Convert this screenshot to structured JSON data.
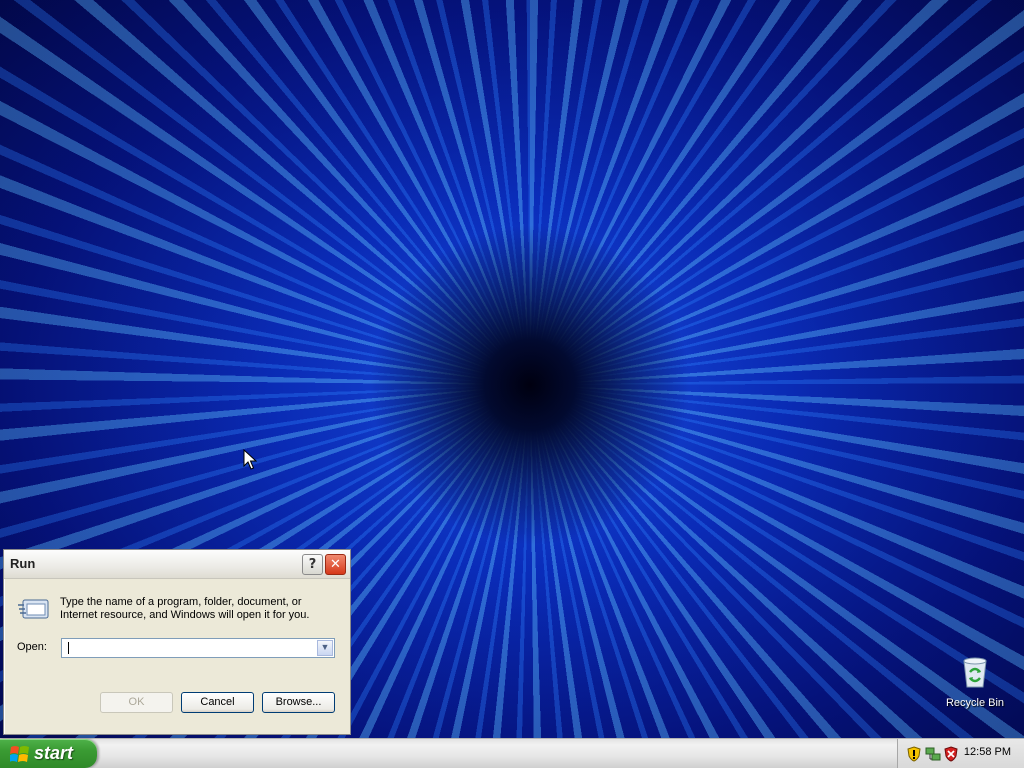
{
  "desktop": {
    "icons": [
      {
        "label": "Recycle Bin",
        "icon": "recycle-bin-icon"
      }
    ]
  },
  "run_dialog": {
    "title": "Run",
    "help_symbol": "?",
    "close_symbol": "✕",
    "description": "Type the name of a program, folder, document, or Internet resource, and Windows will open it for you.",
    "open_label": "Open:",
    "open_value": "",
    "dropdown_symbol": "▼",
    "ok_label": "OK",
    "ok_enabled": false,
    "cancel_label": "Cancel",
    "browse_label": "Browse..."
  },
  "taskbar": {
    "start_label": "start",
    "tray_icons": [
      "security-shield-icon",
      "network-icon",
      "security-alert-icon"
    ],
    "clock": "12:58 PM"
  },
  "colors": {
    "wallpaper_primary": "#0b2fc4",
    "wallpaper_streak": "#50aaff",
    "start_button": "#3a9b33",
    "dialog_bg": "#ece9d8",
    "close_button": "#d6381a"
  }
}
